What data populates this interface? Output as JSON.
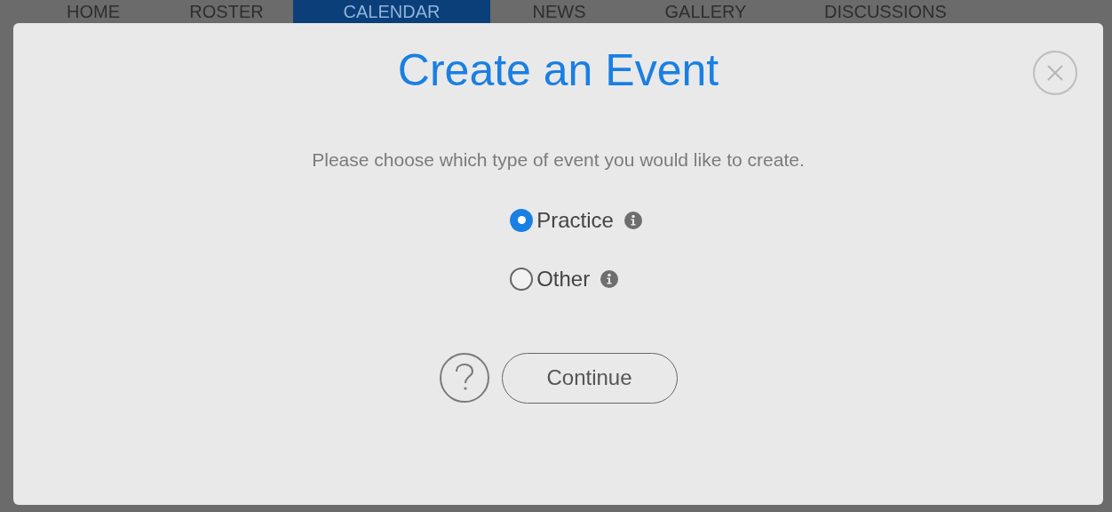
{
  "nav": {
    "items": [
      {
        "label": "HOME",
        "selected": false
      },
      {
        "label": "ROSTER",
        "selected": false
      },
      {
        "label": "CALENDAR",
        "selected": true
      },
      {
        "label": "NEWS",
        "selected": false
      },
      {
        "label": "GALLERY",
        "selected": false
      },
      {
        "label": "DISCUSSIONS",
        "selected": false
      }
    ]
  },
  "dialog": {
    "title": "Create an Event",
    "description": "Please choose which type of event you would like to create.",
    "options": [
      {
        "label": "Practice",
        "selected": true
      },
      {
        "label": "Other",
        "selected": false
      }
    ],
    "continue_button": "Continue"
  }
}
